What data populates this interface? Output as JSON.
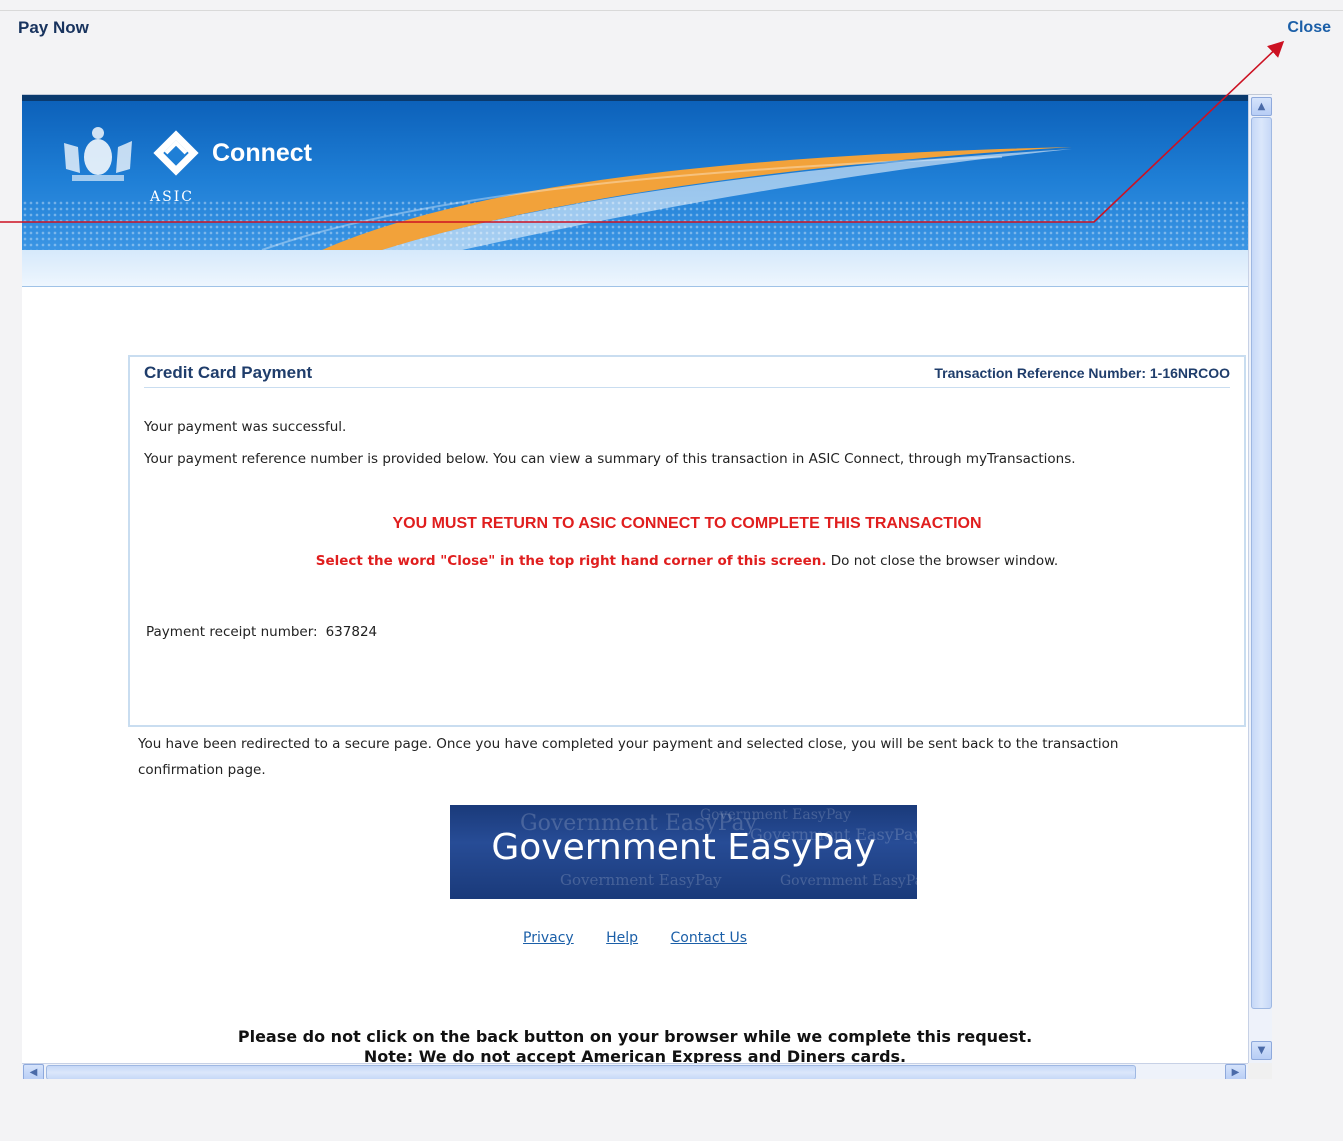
{
  "dialog": {
    "title": "Pay Now",
    "close_label": "Close"
  },
  "banner": {
    "brand": "Connect",
    "agency": "ASIC"
  },
  "payment": {
    "heading": "Credit Card Payment",
    "transaction_reference": "Transaction Reference Number: 1-16NRCOO",
    "success_message": "Your payment was successful.",
    "reference_message": "Your payment reference number is provided below. You can view a summary of this transaction in ASIC Connect, through myTransactions.",
    "warning": "YOU MUST RETURN TO ASIC CONNECT TO COMPLETE THIS TRANSACTION",
    "instruction_red": "Select the word \"Close\" in the top right hand corner of this screen.",
    "instruction_rest": " Do not close the browser window.",
    "receipt_label": "Payment receipt number:",
    "receipt_number": "637824"
  },
  "redirect_message": "You have been redirected to a secure page. Once you have completed your payment and selected close, you will be sent back to the transaction confirmation page.",
  "easypay_logo": {
    "text": "Government EasyPay"
  },
  "footer_links": {
    "privacy": "Privacy",
    "help": "Help",
    "contact": "Contact Us"
  },
  "bottom_notice": {
    "line1": "Please do not click on the back button on your browser while we complete this request.",
    "line2": "Note: We do not accept American Express and Diners cards."
  },
  "colors": {
    "accent_blue": "#1b5fa8",
    "heading_navy": "#1f3d6b",
    "warning_red": "#e01e1e",
    "annotation_red": "#cc1122"
  },
  "icons": {
    "scroll_up": "chevron-up-icon",
    "scroll_down": "chevron-down-icon",
    "scroll_left": "chevron-left-icon",
    "scroll_right": "chevron-right-icon"
  }
}
